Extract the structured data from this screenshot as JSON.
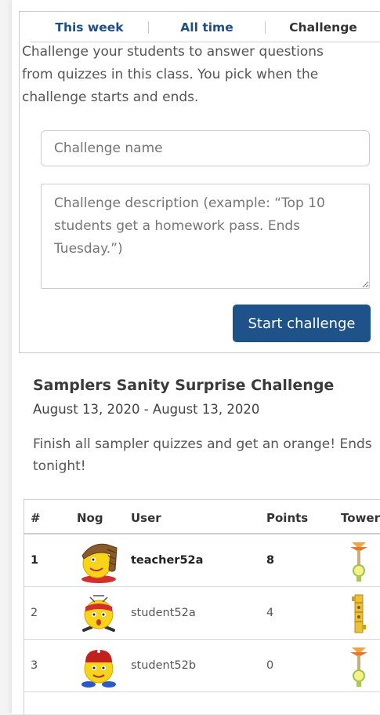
{
  "tabs": [
    "This week",
    "All time",
    "Challenge"
  ],
  "intro": "Challenge your students to answer questions from quizzes in this class. You pick when the challenge starts and ends.",
  "form": {
    "name_placeholder": "Challenge name",
    "desc_placeholder": "Challenge description (example: “Top 10 students get a homework pass. Ends Tuesday.”)",
    "start_button": "Start challenge"
  },
  "challenge": {
    "title": "Samplers Sanity Surprise Challenge",
    "dates": "August 13, 2020 - August 13, 2020",
    "description": "Finish all sampler quizzes and get an orange! Ends tonight!"
  },
  "leaderboard": {
    "columns": [
      "#",
      "Nog",
      "User",
      "Points",
      "Tower"
    ],
    "rows": [
      {
        "rank": "1",
        "user": "teacher52a",
        "points": "8",
        "nog_icon": "nog-brown-hat-icon",
        "tower_icon": "tower-orange-icon"
      },
      {
        "rank": "2",
        "user": "student52a",
        "points": "4",
        "nog_icon": "nog-red-bandana-icon",
        "tower_icon": "tower-yellow-icon"
      },
      {
        "rank": "3",
        "user": "student52b",
        "points": "0",
        "nog_icon": "nog-red-cap-icon",
        "tower_icon": "tower-orange-icon"
      }
    ]
  },
  "colors": {
    "primary": "#1f5289",
    "tab_blue": "#1f4f82"
  }
}
